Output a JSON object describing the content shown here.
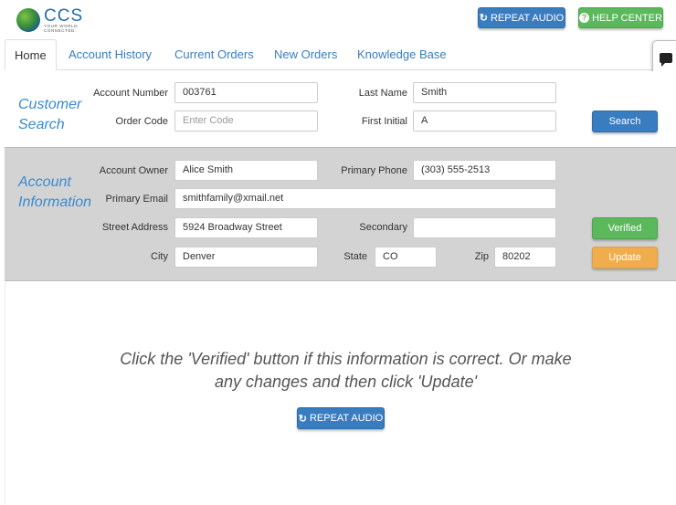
{
  "logo": {
    "text": "CCS",
    "tagline": "YOUR WORLD. CONNECTED."
  },
  "header": {
    "repeat_audio_label": "REPEAT AUDIO",
    "help_center_label": "HELP CENTER"
  },
  "tabs": [
    {
      "label": "Home",
      "active": true
    },
    {
      "label": "Account History"
    },
    {
      "label": "Current Orders"
    },
    {
      "label": "New Orders"
    },
    {
      "label": "Knowledge Base"
    }
  ],
  "customer_search": {
    "title_line1": "Customer",
    "title_line2": "Search",
    "account_number_label": "Account Number",
    "account_number_value": "003761",
    "order_code_label": "Order Code",
    "order_code_placeholder": "Enter Code",
    "last_name_label": "Last Name",
    "last_name_value": "Smith",
    "first_initial_label": "First Initial",
    "first_initial_value": "A",
    "search_button": "Search"
  },
  "account_info": {
    "title_line1": "Account",
    "title_line2": "Information",
    "owner_label": "Account Owner",
    "owner_value": "Alice Smith",
    "phone_label": "Primary Phone",
    "phone_value": "(303) 555-2513",
    "email_label": "Primary Email",
    "email_value": "smithfamily@xmail.net",
    "street_label": "Street Address",
    "street_value": "5924 Broadway Street",
    "secondary_label": "Secondary",
    "secondary_value": "",
    "city_label": "City",
    "city_value": "Denver",
    "state_label": "State",
    "state_value": "CO",
    "zip_label": "Zip",
    "zip_value": "80202",
    "verified_button": "Verified",
    "update_button": "Update"
  },
  "main": {
    "message": "Click the 'Verified' button if this information is correct. Or make any changes and then click 'Update'",
    "repeat_audio_label": "REPEAT AUDIO"
  },
  "colors": {
    "accent_blue": "#3a7cc0",
    "green": "#5cb85c",
    "orange": "#f0ad4e",
    "section_gray": "#d3d3d3"
  }
}
